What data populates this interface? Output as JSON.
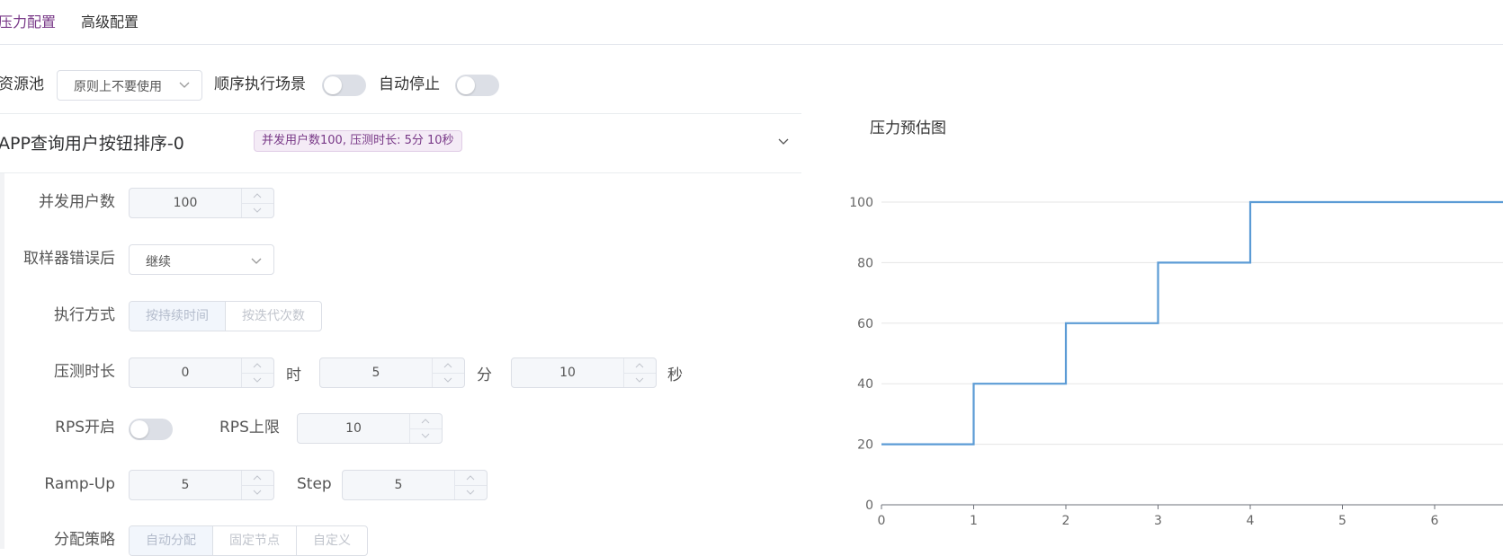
{
  "tabs": [
    {
      "label": "压力配置",
      "active": true
    },
    {
      "label": "高级配置",
      "active": false
    }
  ],
  "top": {
    "resource_pool_label": "资源池",
    "resource_pool_value": "原则上不要使用",
    "sequential_label": "顺序执行场景",
    "sequential_on": false,
    "auto_stop_label": "自动停止",
    "auto_stop_on": false
  },
  "scenario": {
    "title": "APP查询用户按钮排序-0",
    "tag": "并发用户数100, 压测时长: 5分 10秒"
  },
  "form": {
    "concurrency_label": "并发用户数",
    "concurrency_value": "100",
    "on_error_label": "取样器错误后",
    "on_error_value": "继续",
    "exec_mode_label": "执行方式",
    "exec_mode_options": [
      "按持续时间",
      "按迭代次数"
    ],
    "exec_mode_selected": "按持续时间",
    "duration_label": "压测时长",
    "duration_hours": "0",
    "unit_hours": "时",
    "duration_minutes": "5",
    "unit_minutes": "分",
    "duration_seconds": "10",
    "unit_seconds": "秒",
    "rps_label": "RPS开启",
    "rps_on": false,
    "rps_limit_label": "RPS上限",
    "rps_limit_value": "10",
    "rampup_label": "Ramp-Up",
    "rampup_value": "5",
    "step_label": "Step",
    "step_value": "5",
    "strategy_label": "分配策略",
    "strategy_options": [
      "自动分配",
      "固定节点",
      "自定义"
    ],
    "strategy_selected": "自动分配"
  },
  "colors": {
    "accent": "#783887",
    "line": "#5b9bd5"
  },
  "chart_data": {
    "type": "line",
    "title": "压力预估图",
    "step": true,
    "x": [
      0,
      1,
      2,
      3,
      4,
      5,
      6
    ],
    "y": [
      20,
      40,
      60,
      80,
      100,
      100,
      100
    ],
    "xticks": [
      0,
      1,
      2,
      3,
      4,
      5,
      6
    ],
    "yticks": [
      0,
      20,
      40,
      60,
      80,
      100
    ],
    "ylim": [
      0,
      100
    ],
    "grid": true
  }
}
